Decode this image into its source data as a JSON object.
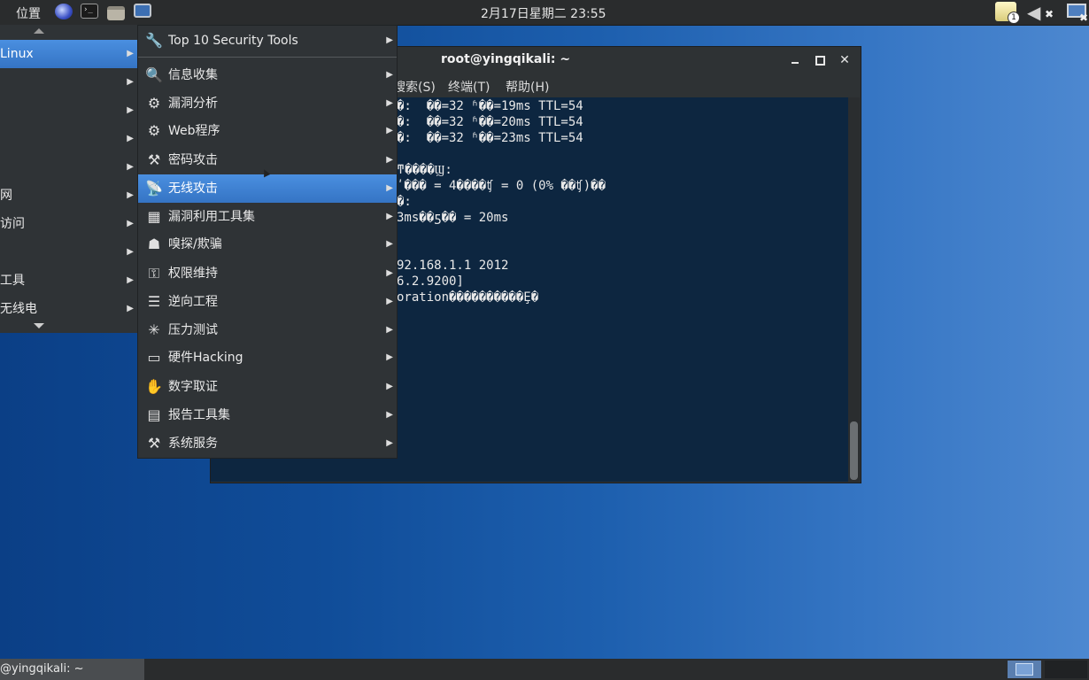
{
  "top_panel": {
    "places_label": "位置",
    "clock": "2月17日星期二 23:55",
    "notification_count": "1",
    "icons": [
      "web-browser-icon",
      "terminal-launcher-icon",
      "files-launcher-icon",
      "screen-launcher-icon",
      "notification-icon",
      "volume-muted-icon",
      "network-disconnected-icon"
    ]
  },
  "apps_menu": {
    "categories": [
      {
        "label": "Linux",
        "active": true
      },
      {
        "label": "",
        "active": false
      },
      {
        "label": "",
        "active": false
      },
      {
        "label": "",
        "active": false
      },
      {
        "label": "",
        "active": false
      },
      {
        "label": "网",
        "active": false
      },
      {
        "label": "访问",
        "active": false
      },
      {
        "label": "",
        "active": false
      },
      {
        "label": "工具",
        "active": false
      },
      {
        "label": "无线电",
        "active": false
      }
    ]
  },
  "submenu": {
    "items": [
      {
        "label": "Top 10 Security Tools",
        "icon": "wrench-icon"
      },
      {
        "label": "信息收集",
        "icon": "magnifier-icon"
      },
      {
        "label": "漏洞分析",
        "icon": "analysis-icon"
      },
      {
        "label": "Web程序",
        "icon": "web-app-icon"
      },
      {
        "label": "密码攻击",
        "icon": "password-attack-icon"
      },
      {
        "label": "无线攻击",
        "icon": "wireless-icon",
        "active": true
      },
      {
        "label": "漏洞利用工具集",
        "icon": "exploit-icon"
      },
      {
        "label": "嗅探/欺骗",
        "icon": "sniffing-icon"
      },
      {
        "label": "权限维持",
        "icon": "privilege-icon"
      },
      {
        "label": "逆向工程",
        "icon": "reverse-engineering-icon"
      },
      {
        "label": "压力测试",
        "icon": "stress-test-icon"
      },
      {
        "label": "硬件Hacking",
        "icon": "hardware-icon"
      },
      {
        "label": "数字取证",
        "icon": "forensics-hand-icon"
      },
      {
        "label": "报告工具集",
        "icon": "report-icon"
      },
      {
        "label": "系统服务",
        "icon": "system-services-icon"
      }
    ]
  },
  "terminal": {
    "title": "root@yingqikali: ~",
    "menus": [
      "搜索(S)",
      "终端(T)",
      "帮助(H)"
    ],
    "lines": [
      "�:  ��=32 ʱ��=19ms TTL=54",
      "�:  ��=32 ʱ��=20ms TTL=54",
      "�:  ��=32 ʱ��=23ms TTL=54",
      "",
      "ͳ����Ϣ:",
      "ʹ��� = 4����ʧ = 0 (0% ��ʧ)��",
      "�:",
      "3ms��ƽ�� = 20ms",
      "",
      "",
      "92.168.1.1 2012",
      "6.2.9200]",
      "oration����������Ȩ�"
    ]
  },
  "bottom_panel": {
    "task_label": "@yingqikali: ~"
  },
  "colors": {
    "panel": "#2a2c2d",
    "menu_bg": "#2f3336",
    "highlight": "#3f82d6",
    "terminal_bg": "#0d2640"
  }
}
